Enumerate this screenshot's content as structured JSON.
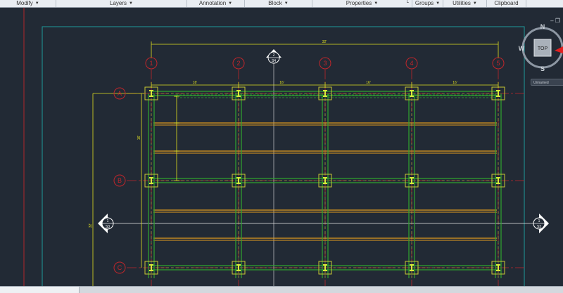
{
  "ribbon": {
    "panels": [
      {
        "label": "Modify"
      },
      {
        "label": "Layers"
      },
      {
        "label": "Annotation"
      },
      {
        "label": "Block"
      },
      {
        "label": "Properties"
      },
      {
        "label": "Groups"
      },
      {
        "label": "Utilities"
      },
      {
        "label": "Clipboard"
      }
    ]
  },
  "viewcube": {
    "face": "TOP",
    "north": "N",
    "south": "S",
    "west": "W"
  },
  "wcs_menu": "Unnamed",
  "drawing": {
    "columns": [
      "1",
      "2",
      "3",
      "4",
      "5"
    ],
    "rows": [
      "A",
      "B",
      "C"
    ],
    "overall_dim": "32'",
    "bay_dims": [
      "16'",
      "16'",
      "16'",
      "16'"
    ],
    "section_mark_top": {
      "num": "2",
      "sheet": "S4"
    },
    "section_mark_left": {
      "num": "1",
      "sheet": "S3"
    },
    "section_mark_right": {
      "num": "1",
      "sheet": "S3"
    },
    "vert_dim": "16'",
    "vert_dim_outer": "32'"
  },
  "colors": {
    "background": "#222a35",
    "grid": "#c0262b",
    "beam": "#2fa52f",
    "joist": "#e09a1f",
    "dim": "#e0e020",
    "column": "#c8c832",
    "border_cyan": "#1d9a9a",
    "border_red": "#b3262a"
  }
}
